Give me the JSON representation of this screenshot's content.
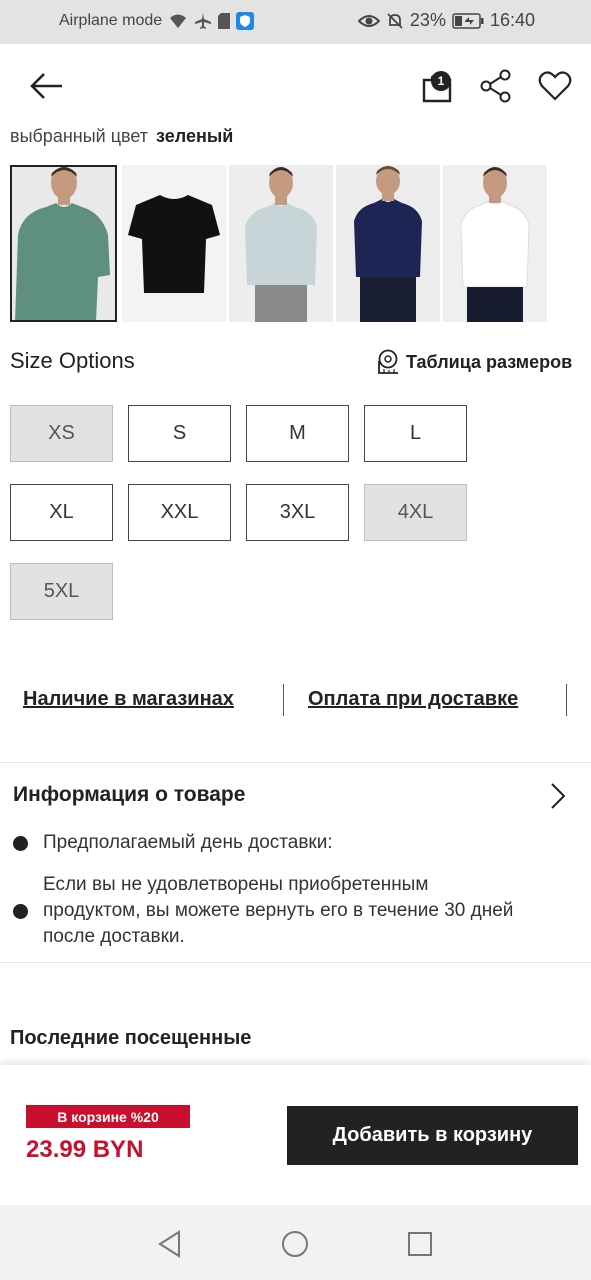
{
  "status_bar": {
    "left_text": "Airplane mode",
    "battery": "23%",
    "time": "16:40"
  },
  "app_bar": {
    "bag_count": "1"
  },
  "color": {
    "label": "выбранный цвет",
    "value": "зеленый"
  },
  "thumbnails": [
    {
      "shirt_color": "#5e8f80",
      "selected": true
    },
    {
      "shirt_color": "#111111",
      "selected": false
    },
    {
      "shirt_color": "#c7d5d8",
      "selected": false
    },
    {
      "shirt_color": "#1c2553",
      "selected": false
    },
    {
      "shirt_color": "#ffffff",
      "selected": false
    }
  ],
  "sizes": {
    "title": "Size Options",
    "chart_label": "Таблица размеров",
    "options": [
      {
        "label": "XS",
        "available": false
      },
      {
        "label": "S",
        "available": true
      },
      {
        "label": "M",
        "available": true
      },
      {
        "label": "L",
        "available": true
      },
      {
        "label": "XL",
        "available": true
      },
      {
        "label": "XXL",
        "available": true
      },
      {
        "label": "3XL",
        "available": true
      },
      {
        "label": "4XL",
        "available": false
      },
      {
        "label": "5XL",
        "available": false
      }
    ]
  },
  "links": {
    "stores": "Наличие в магазинах",
    "cod": "Оплата при доставке"
  },
  "info": {
    "title": "Информация о товаре",
    "delivery": "Предполагаемый день доставки:",
    "return_line1": "Если вы не удовлетворены приобретенным",
    "return_line2": "продуктом, вы можете вернуть его в течение 30 дней",
    "return_line3": "после доставки."
  },
  "recent": {
    "title": "Последние посещенные"
  },
  "buy_bar": {
    "promo": "В корзине %20",
    "price": "23.99 BYN",
    "add_to_cart": "Добавить в корзину"
  },
  "colors": {
    "accent_red": "#c8102e",
    "dark": "#222222"
  }
}
